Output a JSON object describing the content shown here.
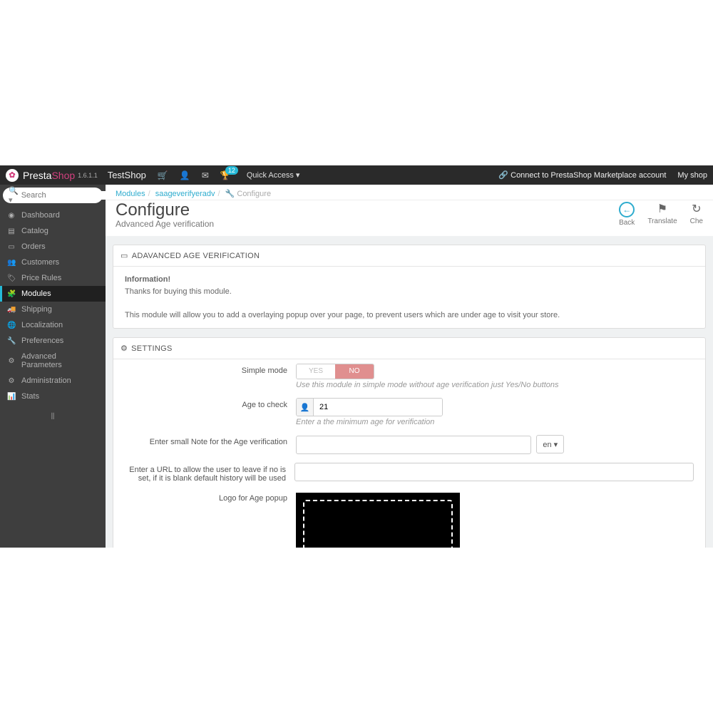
{
  "topbar": {
    "brand_a": "Presta",
    "brand_b": "Shop",
    "version": "1.6.1.1",
    "shop": "TestShop",
    "quick": "Quick Access",
    "badge": "12",
    "connect": "Connect to PrestaShop Marketplace account",
    "myshop": "My shop"
  },
  "search": {
    "placeholder": "Search"
  },
  "nav": [
    {
      "icon": "◉",
      "label": "Dashboard"
    },
    {
      "icon": "▤",
      "label": "Catalog"
    },
    {
      "icon": "▭",
      "label": "Orders"
    },
    {
      "icon": "👥",
      "label": "Customers"
    },
    {
      "icon": "🏷",
      "label": "Price Rules"
    },
    {
      "icon": "🧩",
      "label": "Modules",
      "active": true
    },
    {
      "icon": "🚚",
      "label": "Shipping"
    },
    {
      "icon": "🌐",
      "label": "Localization"
    },
    {
      "icon": "🔧",
      "label": "Preferences"
    },
    {
      "icon": "⚙",
      "label": "Advanced Parameters"
    },
    {
      "icon": "⚙",
      "label": "Administration"
    },
    {
      "icon": "📊",
      "label": "Stats"
    }
  ],
  "crumbs": {
    "a": "Modules",
    "b": "saageverifyeradv",
    "c": "Configure"
  },
  "header": {
    "title": "Configure",
    "subtitle": "Advanced Age verification"
  },
  "actions": {
    "back": "Back",
    "translate": "Translate",
    "check": "Che"
  },
  "panel1": {
    "title": "ADAVANCED AGE VERIFICATION",
    "info_t": "Information!",
    "info_b": "Thanks for buying this module.",
    "desc": "This module will allow you to add a overlaying popup over your page, to prevent users which are under age to visit your store."
  },
  "settings": {
    "title": "SETTINGS",
    "simple": {
      "label": "Simple mode",
      "yes": "YES",
      "no": "NO",
      "help": "Use this module in simple mode without age verification just Yes/No buttons"
    },
    "age": {
      "label": "Age to check",
      "value": "21",
      "help": "Enter a the minimum age for verification"
    },
    "note": {
      "label": "Enter small Note for the Age verification",
      "lang": "en"
    },
    "url": {
      "label": "Enter a URL to allow the user to leave if no is set, if it is blank default history will be used"
    },
    "logo": {
      "label": "Logo for Age popup"
    }
  }
}
